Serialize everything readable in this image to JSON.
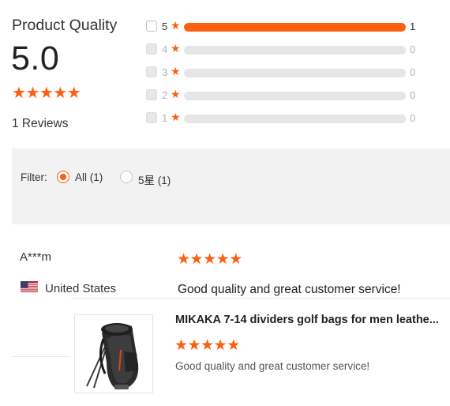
{
  "colors": {
    "accent": "#fe5e10",
    "bar_track": "#e6e6e6",
    "filter_bg": "#f2f2f2"
  },
  "icons": {
    "star": "★",
    "flag": "us-flag-icon",
    "product_image": "golf-bag-image"
  },
  "summary": {
    "title": "Product Quality",
    "score": "5.0",
    "rating_stars": 5,
    "reviews_label": "1 Reviews"
  },
  "distribution": [
    {
      "level": "5",
      "count": "1",
      "fraction": 1.0,
      "enabled": true
    },
    {
      "level": "4",
      "count": "0",
      "fraction": 0.0,
      "enabled": false
    },
    {
      "level": "3",
      "count": "0",
      "fraction": 0.0,
      "enabled": false
    },
    {
      "level": "2",
      "count": "0",
      "fraction": 0.0,
      "enabled": false
    },
    {
      "level": "1",
      "count": "0",
      "fraction": 0.0,
      "enabled": false
    }
  ],
  "filter": {
    "label": "Filter:",
    "options": [
      {
        "label": "All (1)",
        "selected": true
      },
      {
        "label": "5星 (1)",
        "selected": false
      }
    ]
  },
  "review": {
    "user": "A***m",
    "country": "United States",
    "rating_stars": 5,
    "text": "Good quality and great customer service!",
    "product": {
      "title": "MIKAKA 7-14 dividers golf bags for men leathe...",
      "rating_stars": 5,
      "text": "Good quality and great customer service!"
    }
  }
}
